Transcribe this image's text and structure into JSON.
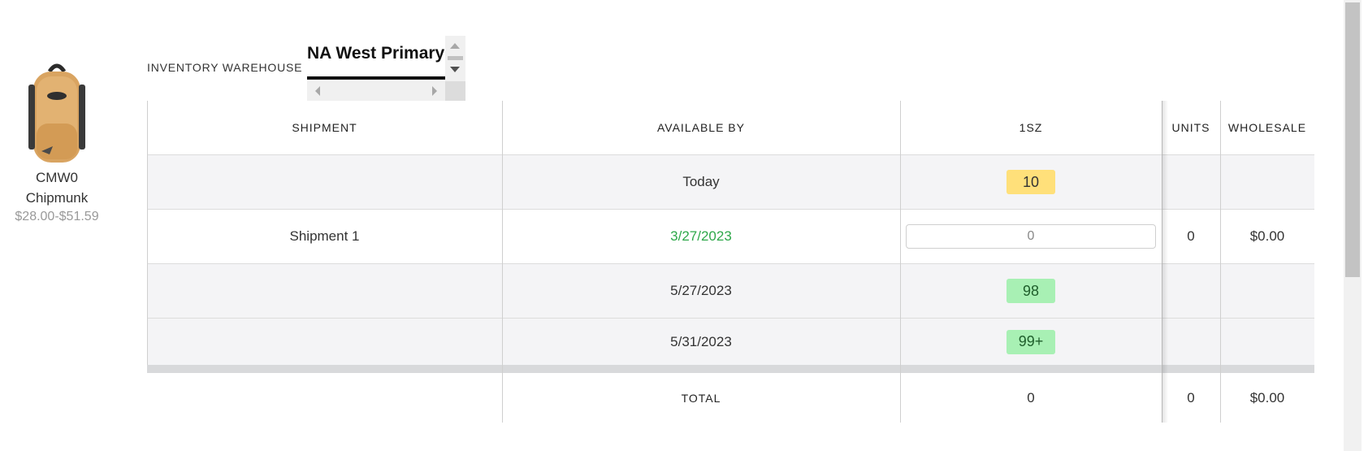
{
  "product": {
    "sku": "CMW0",
    "name": "Chipmunk",
    "price_range": "$28.00-$51.59",
    "image_icon": "backpack-icon"
  },
  "warehouse": {
    "label": "INVENTORY WAREHOUSE",
    "selected": "NA West Primary"
  },
  "table": {
    "headers": {
      "shipment": "SHIPMENT",
      "available_by": "AVAILABLE BY",
      "size": "1SZ",
      "units": "UNITS",
      "wholesale": "WHOLESALE"
    },
    "rows": [
      {
        "shipment": "",
        "available_by": "Today",
        "availability": "10",
        "availability_color": "yellow",
        "units": "",
        "wholesale": ""
      },
      {
        "shipment": "Shipment 1",
        "available_by": "3/27/2023",
        "available_by_color": "#2ea84a",
        "quantity_placeholder": "0",
        "units": "0",
        "wholesale": "$0.00"
      },
      {
        "shipment": "",
        "available_by": "5/27/2023",
        "availability": "98",
        "availability_color": "green",
        "units": "",
        "wholesale": ""
      },
      {
        "shipment": "",
        "available_by": "5/31/2023",
        "availability": "99+",
        "availability_color": "green",
        "units": "",
        "wholesale": ""
      }
    ],
    "total": {
      "label": "TOTAL",
      "size_total": "0",
      "units": "0",
      "wholesale": "$0.00"
    }
  },
  "colors": {
    "badge_yellow": "#ffe07a",
    "badge_green": "#a8f0b4",
    "date_green": "#2ea84a",
    "row_alt": "#f4f4f6"
  }
}
